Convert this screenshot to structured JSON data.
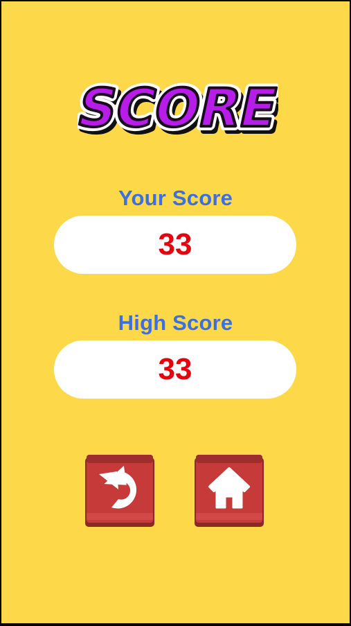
{
  "title": "SCORE",
  "your_score": {
    "label": "Your Score",
    "value": "33"
  },
  "high_score": {
    "label": "High Score",
    "value": "33"
  },
  "buttons": {
    "replay_icon": "replay-arrow-icon",
    "home_icon": "home-icon"
  },
  "colors": {
    "background": "#FDD94A",
    "title_fill": "#B81CE8",
    "label_text": "#3C6FE0",
    "score_text": "#E8000D",
    "pill": "#FFFFFF",
    "button": "#C73A3A"
  }
}
